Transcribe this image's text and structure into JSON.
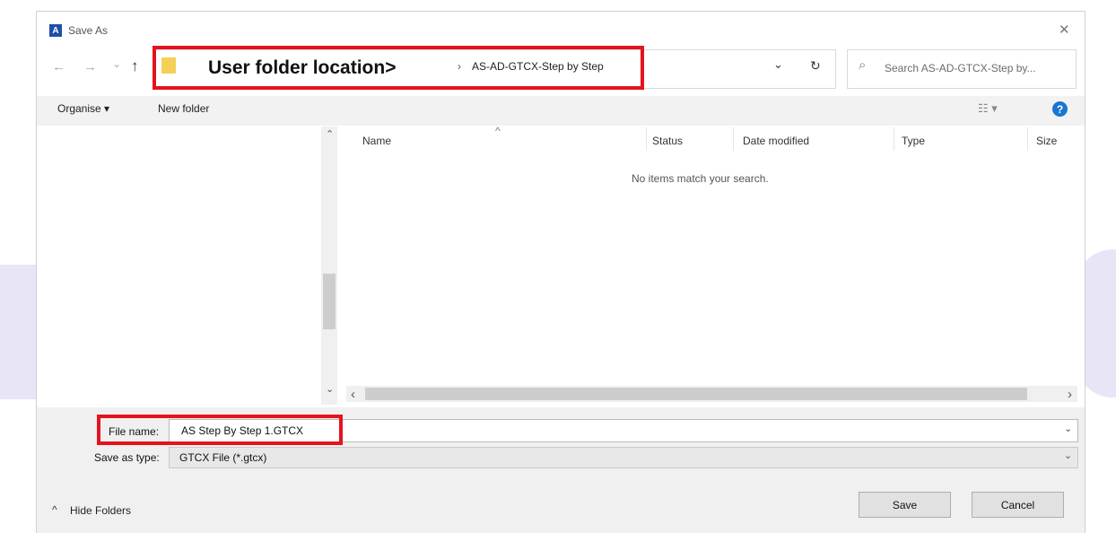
{
  "window": {
    "title": "Save As",
    "close_glyph": "✕",
    "app_icon_letter": "A"
  },
  "nav": {
    "back": "←",
    "forward": "→",
    "recent": "⌄",
    "up": "↑"
  },
  "address": {
    "annotation": "User folder location>",
    "separator": "›",
    "current_folder": "AS-AD-GTCX-Step by Step",
    "dropdown": "⌄",
    "refresh": "↻"
  },
  "search": {
    "icon": "⌕",
    "placeholder": "Search AS-AD-GTCX-Step by..."
  },
  "toolbar": {
    "organise": "Organise ▾",
    "new_folder": "New folder",
    "view": "☷ ▾",
    "help": "?"
  },
  "file_list": {
    "columns": [
      "Name",
      "Status",
      "Date modified",
      "Type",
      "Size"
    ],
    "sort_indicator": "^",
    "empty_message": "No items match your search."
  },
  "scroll": {
    "up": "⌃",
    "down": "⌄",
    "left": "‹",
    "right": "›"
  },
  "form": {
    "file_name_label": "File name:",
    "file_name_value": "AS Step By Step 1.GTCX",
    "save_type_label": "Save as type:",
    "save_type_value": "GTCX File (*.gtcx)",
    "dropdown_glyph": "⌄"
  },
  "footer": {
    "hide_folders": "Hide Folders",
    "hide_glyph": "^",
    "save": "Save",
    "cancel": "Cancel"
  },
  "colors": {
    "annotation_red": "#e3141f",
    "accent_blue": "#1976d2",
    "folder_yellow": "#f6cf57"
  },
  "icons": [
    "app-icon",
    "close-icon",
    "back-arrow-icon",
    "forward-arrow-icon",
    "up-arrow-icon",
    "folder-icon",
    "chevron-right-icon",
    "refresh-icon",
    "search-icon",
    "view-options-icon",
    "help-icon",
    "chevron-down-icon"
  ]
}
